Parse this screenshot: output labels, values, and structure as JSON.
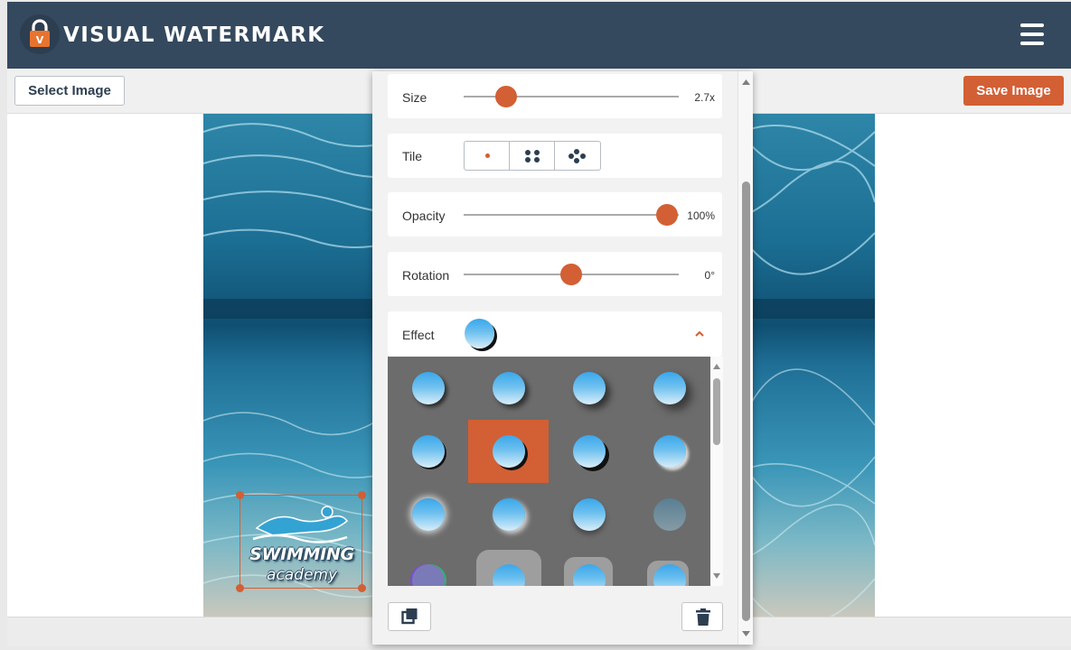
{
  "app": {
    "title": "VISUAL WATERMARK",
    "logo_letter": "V"
  },
  "toolbar": {
    "select_label": "Select Image",
    "save_label": "Save Image"
  },
  "colors": {
    "accent": "#d35f34",
    "header": "#34495e",
    "effect_bg": "#6c6c6c"
  },
  "settings": {
    "size": {
      "label": "Size",
      "value": "2.7x",
      "level": 0.2
    },
    "tile": {
      "label": "Tile",
      "options": [
        "single",
        "grid",
        "scatter"
      ],
      "selected": "single"
    },
    "opacity": {
      "label": "Opacity",
      "value": "100%",
      "level": 1.0
    },
    "rotation": {
      "label": "Rotation",
      "value": "0°",
      "level": 0.5
    },
    "effect": {
      "label": "Effect",
      "expanded": true,
      "selected_index": 5
    }
  },
  "watermark": {
    "line1": "SWIMMING",
    "line2": "academy"
  },
  "actions": {
    "duplicate_icon": "copy-icon",
    "delete_icon": "trash-icon"
  }
}
